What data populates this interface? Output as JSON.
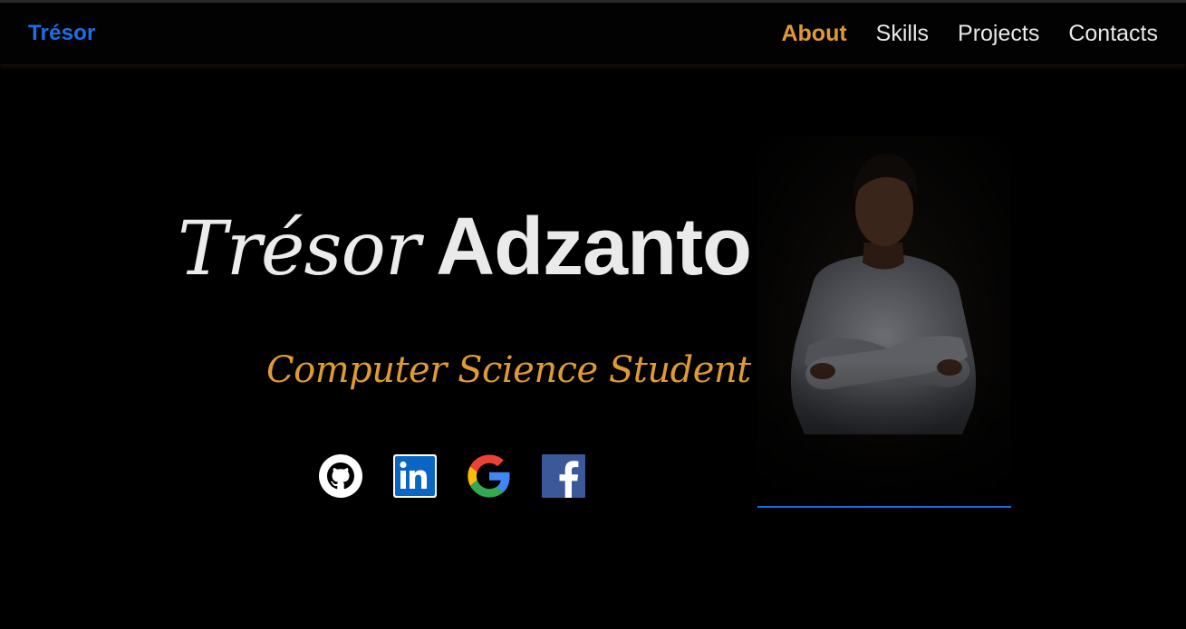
{
  "navbar": {
    "brand": "Trésor",
    "links": [
      {
        "label": "About",
        "active": true
      },
      {
        "label": "Skills",
        "active": false
      },
      {
        "label": "Projects",
        "active": false
      },
      {
        "label": "Contacts",
        "active": false
      }
    ]
  },
  "hero": {
    "first_name": "Trésor",
    "last_name": "Adzanto",
    "subtitle": "Computer Science Student",
    "social": [
      {
        "icon": "github-icon"
      },
      {
        "icon": "linkedin-icon"
      },
      {
        "icon": "google-icon"
      },
      {
        "icon": "facebook-icon"
      }
    ]
  },
  "colors": {
    "background": "#000000",
    "brand_blue": "#1d6fe8",
    "accent_orange": "#e09a32",
    "text_light": "#e9e9e9",
    "linkedin_blue": "#0a66c2",
    "facebook_blue": "#3b5998"
  }
}
